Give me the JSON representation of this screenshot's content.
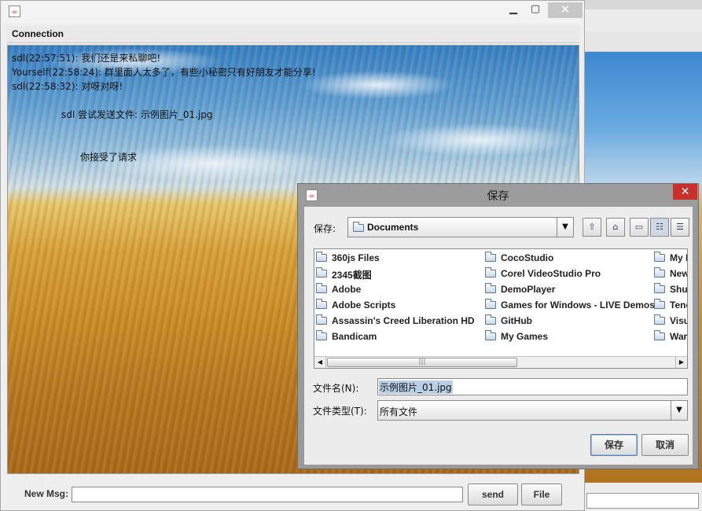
{
  "chat_window": {
    "menu": {
      "connection": "Connection"
    },
    "messages": [
      "sdl(22:57:51): 我们还是来私聊吧!",
      "Yourself(22:58:24): 群里面人太多了，有些小秘密只有好朋友才能分享!",
      "sdl(22:58:32): 对呀对呀!"
    ],
    "file_notice": "sdl 尝试发送文件: 示例图片_01.jpg",
    "accept_notice": "你接受了请求",
    "new_msg_label": "New Msg:",
    "new_msg_value": "",
    "send_label": "send",
    "file_label": "File",
    "window_controls": {
      "minimize": "▁",
      "maximize": "▢",
      "close": "✕"
    }
  },
  "save_dialog": {
    "title": "保存",
    "close": "✕",
    "save_in_label": "保存:",
    "save_in_value": "Documents",
    "combo_arrow": "▼",
    "toolbar": {
      "up": "⇧",
      "home": "⌂",
      "new_folder": "▭",
      "list_view": "☷",
      "details_view": "☰"
    },
    "files": [
      [
        "360js Files",
        "2345截图",
        "Adobe",
        "Adobe Scripts",
        "Assassin's Creed Liberation HD",
        "Bandicam"
      ],
      [
        "CocoStudio",
        "Corel VideoStudio Pro",
        "DemoPlayer",
        "Games for Windows - LIVE Demos",
        "GitHub",
        "My Games"
      ],
      [
        "My I",
        "New",
        "Shu",
        "Tenc",
        "Visu",
        "War"
      ]
    ],
    "scroll": {
      "left": "◀",
      "right": "▶",
      "grip": "|||"
    },
    "file_name_label": "文件名(N):",
    "file_name_value": "示例图片_01.jpg",
    "file_type_label": "文件类型(T):",
    "file_type_value": "所有文件",
    "save_label": "保存",
    "cancel_label": "取消"
  },
  "icons": {
    "app": "java-cup-icon",
    "folder": "folder-icon"
  }
}
